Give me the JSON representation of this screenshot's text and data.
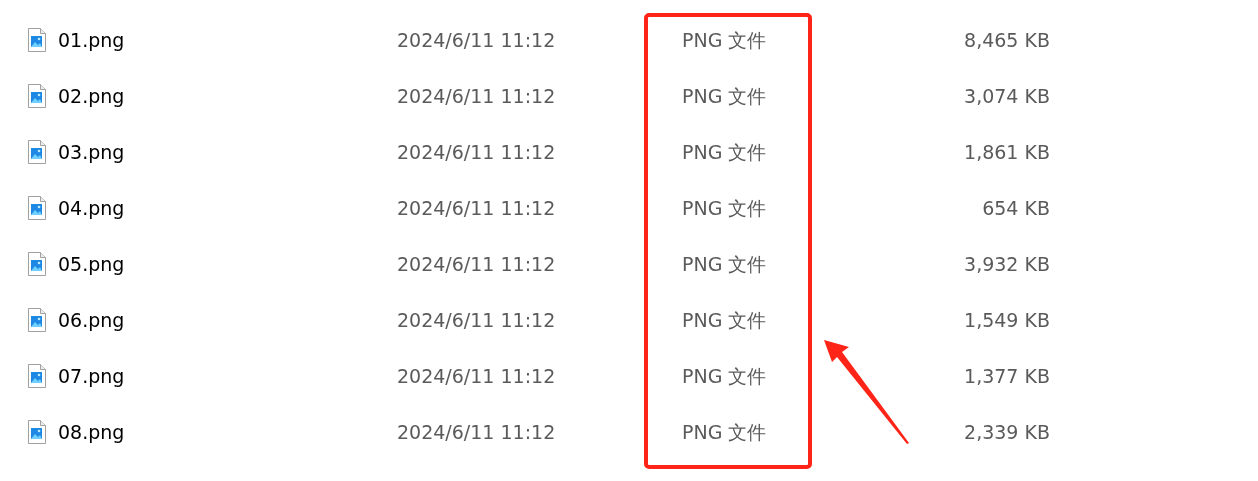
{
  "files": [
    {
      "name": "01.png",
      "modified": "2024/6/11 11:12",
      "type": "PNG 文件",
      "size": "8,465 KB"
    },
    {
      "name": "02.png",
      "modified": "2024/6/11 11:12",
      "type": "PNG 文件",
      "size": "3,074 KB"
    },
    {
      "name": "03.png",
      "modified": "2024/6/11 11:12",
      "type": "PNG 文件",
      "size": "1,861 KB"
    },
    {
      "name": "04.png",
      "modified": "2024/6/11 11:12",
      "type": "PNG 文件",
      "size": "654 KB"
    },
    {
      "name": "05.png",
      "modified": "2024/6/11 11:12",
      "type": "PNG 文件",
      "size": "3,932 KB"
    },
    {
      "name": "06.png",
      "modified": "2024/6/11 11:12",
      "type": "PNG 文件",
      "size": "1,549 KB"
    },
    {
      "name": "07.png",
      "modified": "2024/6/11 11:12",
      "type": "PNG 文件",
      "size": "1,377 KB"
    },
    {
      "name": "08.png",
      "modified": "2024/6/11 11:12",
      "type": "PNG 文件",
      "size": "2,339 KB"
    }
  ],
  "annotations": {
    "highlight_box": true,
    "arrow": true
  }
}
